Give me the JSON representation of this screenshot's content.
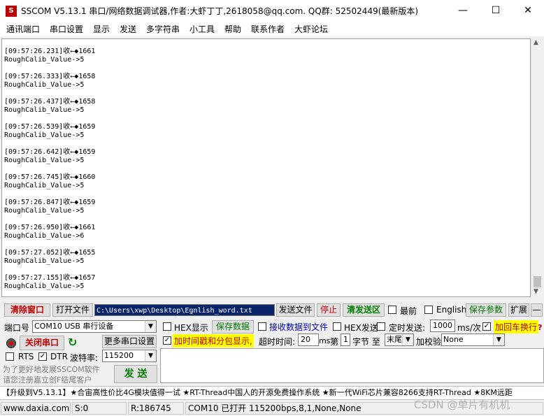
{
  "window": {
    "title": "SSCOM V5.13.1 串口/网络数据调试器,作者:大虾丁丁,2618058@qq.com. QQ群: 52502449(最新版本)",
    "icon_name": "sscom-app-icon",
    "minimize": "—",
    "maximize": "☐",
    "close": "✕"
  },
  "menu": [
    "通讯端口",
    "串口设置",
    "显示",
    "发送",
    "多字符串",
    "小工具",
    "帮助",
    "联系作者",
    "大虾论坛"
  ],
  "receive": {
    "lines": [
      "[09:57:26.231]收←◆1661",
      "RoughCalib_Value->5",
      "[09:57:26.333]收←◆1658",
      "RoughCalib_Value->5",
      "[09:57:26.437]收←◆1658",
      "RoughCalib_Value->5",
      "[09:57:26.539]收←◆1659",
      "RoughCalib_Value->5",
      "[09:57:26.642]收←◆1659",
      "RoughCalib_Value->5",
      "[09:57:26.745]收←◆1660",
      "RoughCalib_Value->5",
      "[09:57:26.847]收←◆1659",
      "RoughCalib_Value->5",
      "[09:57:26.950]收←◆1661",
      "RoughCalib_Value->6",
      "[09:57:27.052]收←◆1655",
      "RoughCalib_Value->5",
      "[09:57:27.155]收←◆1657",
      "RoughCalib_Value->5"
    ]
  },
  "row1": {
    "clear": "清除窗口",
    "open_file": "打开文件",
    "file_path": "C:\\Users\\xwp\\Desktop\\Egnlish_word.txt",
    "send_file": "发送文件",
    "stop": "停止",
    "clear_send": "清发送区",
    "topmost": "最前",
    "english": "English",
    "save_params": "保存参数",
    "expand": "扩展",
    "collapse": "—"
  },
  "row2": {
    "port_label": "端口号",
    "port_value": "COM10 USB 串行设备",
    "hex_display": "HEX显示",
    "save_data": "保存数据",
    "recv_to_file": "接收数据到文件",
    "hex_send": "HEX发送",
    "timed_send": "定时发送:",
    "interval": "1000",
    "interval_unit": "ms/次",
    "add_crlf": "加回车换行"
  },
  "row3": {
    "close_port": "关闭串口",
    "more_settings": "更多串口设置",
    "add_timestamp": "加时间戳和分包显示,",
    "timeout_label": "超时时间:",
    "timeout_value": "20",
    "timeout_unit": "ms",
    "nth_label": "第",
    "byte_index": "1",
    "byte_label": "字节 至",
    "byte_end": "末尾",
    "checksum_label": "加校验",
    "checksum_value": "None"
  },
  "row4": {
    "rts": "RTS",
    "dtr": "DTR",
    "baud_label": "波特率:",
    "baud_value": "115200"
  },
  "send_panel": {
    "promo_text": "为了更好地发展SSCOM软件\n请您注册嘉立创F结尾客户",
    "send_button": "发 送"
  },
  "promo_bar": "【升级到V5.13.1】★合宙高性价比4G模块值得一试 ★RT-Thread中国人的开源免费操作系统 ★新一代WiFi芯片兼容8266支持RT-Thread ★8KM远距",
  "status": {
    "website": "www.daxia.com",
    "sent": "S:0",
    "received": "R:186745",
    "port_status": "COM10 已打开  115200bps,8,1,None,None"
  },
  "watermark": "CSDN @单片有机机",
  "colors": {
    "accent_red": "#c00000",
    "accent_green": "#008000",
    "highlight_yellow": "#ffff00",
    "path_bg": "#0a246a"
  }
}
